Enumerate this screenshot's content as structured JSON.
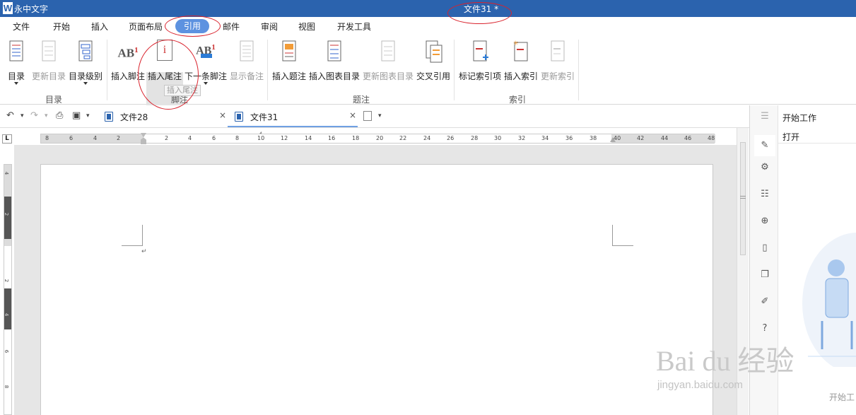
{
  "app": {
    "name": "永中文字",
    "logo_letter": "W",
    "document_title": "文件31 *"
  },
  "menu": {
    "items": [
      "文件",
      "开始",
      "插入",
      "页面布局",
      "引用",
      "邮件",
      "审阅",
      "视图",
      "开发工具"
    ],
    "active": "引用"
  },
  "ribbon": {
    "groups": [
      {
        "label": "目录",
        "buttons": [
          {
            "label": "目录",
            "enabled": true,
            "dropdown": true
          },
          {
            "label": "更新目录",
            "enabled": false
          },
          {
            "label": "目录级别",
            "enabled": true,
            "dropdown": true
          }
        ]
      },
      {
        "label": "脚注",
        "buttons": [
          {
            "label": "插入脚注",
            "enabled": true
          },
          {
            "label": "插入尾注",
            "enabled": true
          },
          {
            "label": "下一条脚注",
            "enabled": true,
            "dropdown": true
          },
          {
            "label": "显示备注",
            "enabled": false
          }
        ]
      },
      {
        "label": "题注",
        "buttons": [
          {
            "label": "插入题注",
            "enabled": true
          },
          {
            "label": "插入图表目录",
            "enabled": true
          },
          {
            "label": "更新图表目录",
            "enabled": false
          },
          {
            "label": "交叉引用",
            "enabled": true
          }
        ]
      },
      {
        "label": "索引",
        "buttons": [
          {
            "label": "标记索引项",
            "enabled": true
          },
          {
            "label": "插入索引",
            "enabled": true
          },
          {
            "label": "更新索引",
            "enabled": false
          }
        ]
      }
    ],
    "tooltip": "插入尾注",
    "icon_text": {
      "ab": "AB",
      "sup1": "1",
      "endnote_i": "i"
    }
  },
  "quick_access": {
    "undo_icon": "↶",
    "redo_icon": "↷",
    "dropdown_arrow": "▾",
    "print_preview_icon": "⎙",
    "save_icon": "▣"
  },
  "doc_tabs": [
    {
      "name": "文件28",
      "active": false,
      "close": "×"
    },
    {
      "name": "文件31",
      "active": true,
      "close": "×"
    }
  ],
  "ruler": {
    "corner": "L",
    "ticks": [
      "8",
      "6",
      "4",
      "2",
      "2",
      "4",
      "6",
      "8",
      "10",
      "12",
      "14",
      "16",
      "18",
      "20",
      "22",
      "24",
      "26",
      "28",
      "30",
      "32",
      "34",
      "36",
      "38",
      "40",
      "42",
      "44",
      "46",
      "48"
    ],
    "vticks": [
      "4",
      "2",
      "2",
      "4",
      "6",
      "8"
    ]
  },
  "document": {
    "paragraph_mark": "↵"
  },
  "side_pane": {
    "title": "开始工作",
    "open": "打开",
    "start_label": "开始工",
    "icons": [
      "pencil-icon",
      "sliders-icon",
      "outline-icon",
      "lock-icon",
      "bookmark-icon",
      "copy-icon",
      "edit-icon",
      "help-icon"
    ]
  },
  "watermark": {
    "main": "Bai du 经验",
    "sub": "jingyan.baidu.com"
  },
  "colors": {
    "titlebar": "#2b63ae",
    "active_tab": "#5d92e0",
    "annotation": "#d9232d"
  }
}
